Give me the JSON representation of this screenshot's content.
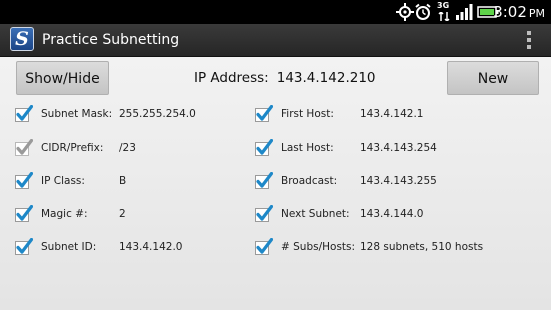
{
  "status_bar": {
    "time": "3:02",
    "time_suffix": "PM",
    "network_label": "3G"
  },
  "action_bar": {
    "logo_letter": "S",
    "title": "Practice Subnetting"
  },
  "toolbar": {
    "show_hide_label": "Show/Hide",
    "ip_label": "IP Address:",
    "ip_value": "143.4.142.210",
    "new_label": "New"
  },
  "fields": {
    "subnet_mask": {
      "label": "Subnet Mask:",
      "value": "255.255.254.0",
      "checked": true
    },
    "cidr_prefix": {
      "label": "CIDR/Prefix:",
      "value": "/23",
      "checked": true,
      "disabled": true
    },
    "ip_class": {
      "label": "IP Class:",
      "value": "B",
      "checked": true
    },
    "magic_number": {
      "label": "Magic #:",
      "value": "2",
      "checked": true
    },
    "subnet_id": {
      "label": "Subnet ID:",
      "value": "143.4.142.0",
      "checked": true
    },
    "first_host": {
      "label": "First Host:",
      "value": "143.4.142.1",
      "checked": true
    },
    "last_host": {
      "label": "Last Host:",
      "value": "143.4.143.254",
      "checked": true
    },
    "broadcast": {
      "label": "Broadcast:",
      "value": "143.4.143.255",
      "checked": true
    },
    "next_subnet": {
      "label": "Next Subnet:",
      "value": "143.4.144.0",
      "checked": true
    },
    "subs_hosts": {
      "label": "# Subs/Hosts:",
      "value": "128 subnets, 510 hosts",
      "checked": true
    }
  },
  "colors": {
    "check_active": "#1e88c8",
    "check_disabled": "#9a9a9a",
    "action_bar": "#2e2e2e",
    "logo_blue": "#2a5aa0"
  }
}
